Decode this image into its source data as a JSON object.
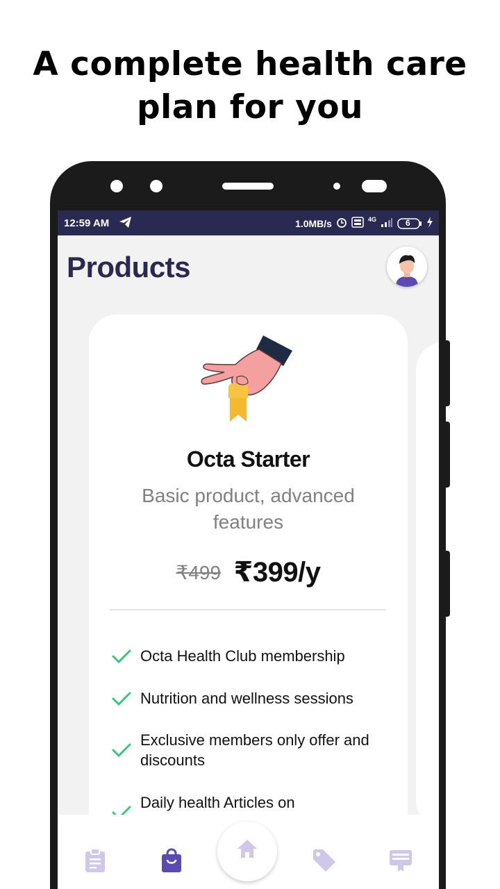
{
  "headline": "A complete health care plan for you",
  "status_bar": {
    "time": "12:59 AM",
    "net_speed": "1.0MB/s",
    "network": "4G",
    "battery": "6"
  },
  "header": {
    "title": "Products"
  },
  "plan": {
    "name": "Octa Starter",
    "description": "Basic product, advanced features",
    "old_price": "₹499",
    "price": "₹399/y",
    "features": [
      "Octa Health Club membership",
      "Nutrition and wellness sessions",
      "Exclusive members only offer and discounts",
      "Daily health Articles on"
    ]
  },
  "nav": {
    "items": [
      "clipboard-icon",
      "bag-icon",
      "home-icon",
      "tag-icon",
      "card-icon"
    ],
    "active": "bag-icon"
  },
  "colors": {
    "primary": "#2a2952",
    "accent": "#5b4ab0",
    "check": "#3cc47c",
    "muted": "#808080",
    "nav_inactive": "#cfc8e8"
  }
}
